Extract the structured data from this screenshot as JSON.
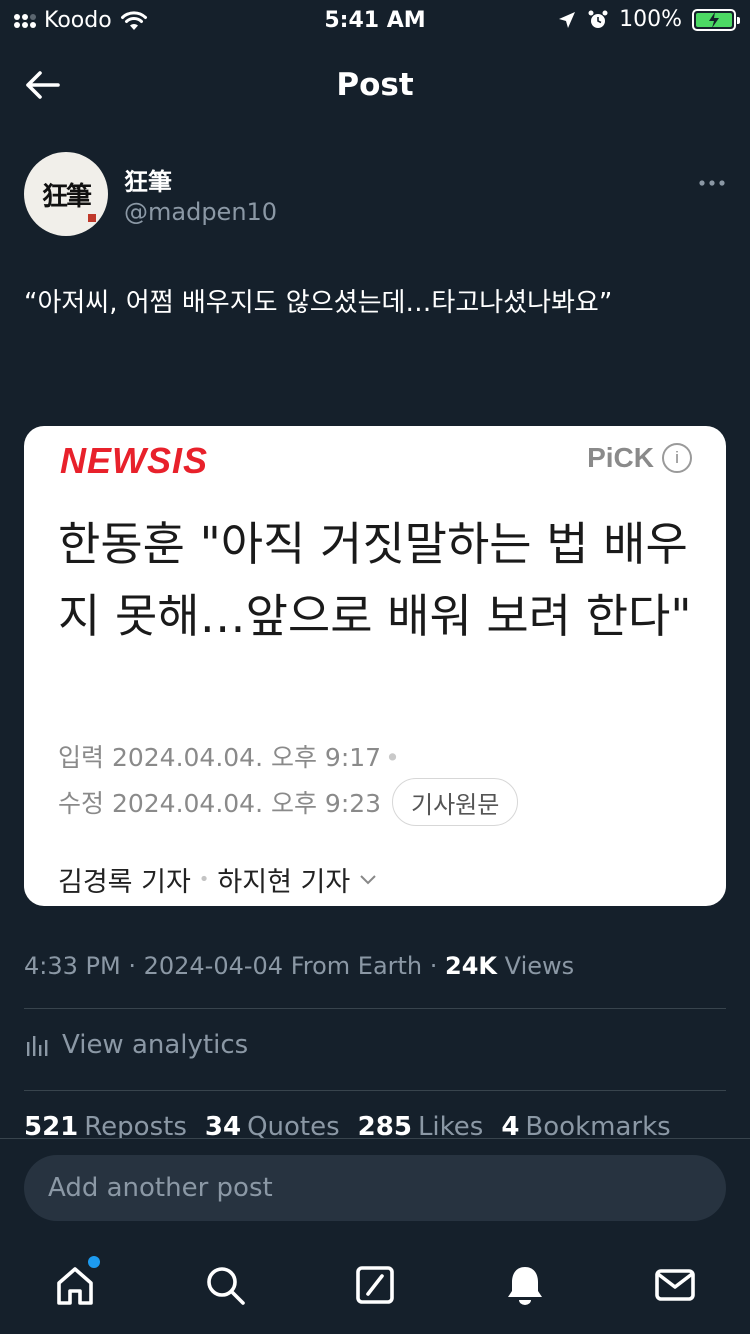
{
  "status_bar": {
    "carrier": "Koodo",
    "time": "5:41 AM",
    "battery": "100%"
  },
  "header": {
    "title": "Post"
  },
  "author": {
    "display_name": "狂筆",
    "handle": "@madpen10",
    "avatar_text": "狂筆"
  },
  "post": {
    "text": "“아저씨, 어쩜 배우지도 않으셨는데…타고나셨나봐요”"
  },
  "news_card": {
    "logo": "NEWSIS",
    "pick_label": "PiCK",
    "headline": "한동훈 \"아직 거짓말하는 법 배우지 못해…앞으로 배워 보려 한다\"",
    "input_label": "입력 2024.04.04. 오후 9:17",
    "edited_label": "수정 2024.04.04. 오후 9:23",
    "source_button": "기사원문",
    "reporter_1": "김경록 기자",
    "reporter_2": "하지현 기자"
  },
  "meta": {
    "time": "4:33 PM · 2024-04-04 From Earth · ",
    "views_count": "24K",
    "views_label": "Views"
  },
  "analytics": {
    "label": "View analytics"
  },
  "engagement": {
    "reposts_count": "521",
    "reposts_label": "Reposts",
    "quotes_count": "34",
    "quotes_label": "Quotes",
    "likes_count": "285",
    "likes_label": "Likes",
    "bookmarks_count": "4",
    "bookmarks_label": "Bookmarks"
  },
  "reply": {
    "placeholder": "Add another post"
  },
  "tabs": [
    "home-icon",
    "search-icon",
    "compose-icon",
    "notifications-icon",
    "messages-icon"
  ],
  "colors": {
    "background": "#15202b",
    "secondary_text": "#8b98a5",
    "accent": "#1d9bf0",
    "newsis_red": "#e8212b"
  }
}
